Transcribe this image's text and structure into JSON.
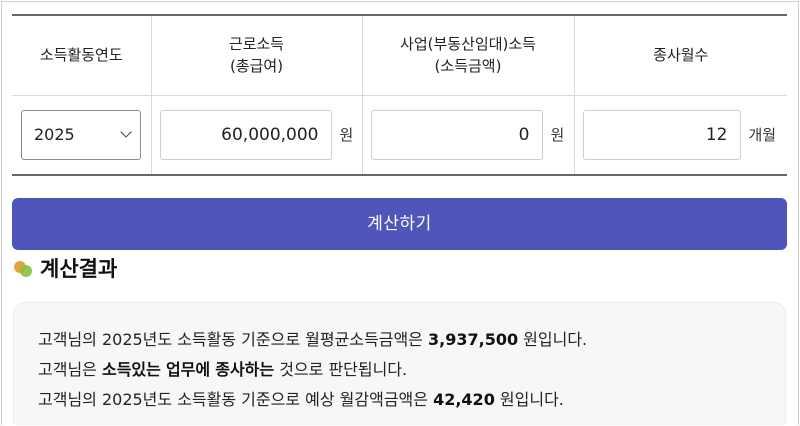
{
  "table": {
    "headers": [
      {
        "line1": "소득활동연도",
        "line2": ""
      },
      {
        "line1": "근로소득",
        "line2": "(총급여)"
      },
      {
        "line1": "사업(부동산임대)소득",
        "line2": "(소득금액)"
      },
      {
        "line1": "종사월수",
        "line2": ""
      }
    ],
    "year_select": {
      "value": "2025"
    },
    "earned_income": {
      "value": "60,000,000",
      "unit": "원"
    },
    "business_income": {
      "value": "0",
      "unit": "원"
    },
    "months": {
      "value": "12",
      "unit": "개월"
    }
  },
  "calc_button": {
    "label": "계산하기"
  },
  "result": {
    "title": "계산결과",
    "line1": {
      "pre": "고객님의 2025년도 소득활동 기준으로 월평균소득금액은 ",
      "value": "3,937,500",
      "post": " 원입니다."
    },
    "line2": {
      "pre": "고객님은 ",
      "bold1": "소득있는",
      "mid1": " ",
      "bold2": "업무에",
      "mid2": " ",
      "bold3": "종사하는",
      "post": " 것으로 판단됩니다."
    },
    "line3": {
      "pre": "고객님의 2025년도 소득활동 기준으로 예상 월감액금액은 ",
      "value": "42,420",
      "post": " 원입니다."
    }
  },
  "colors": {
    "button": "#5056b9",
    "result_bg": "#f7f7f8"
  }
}
